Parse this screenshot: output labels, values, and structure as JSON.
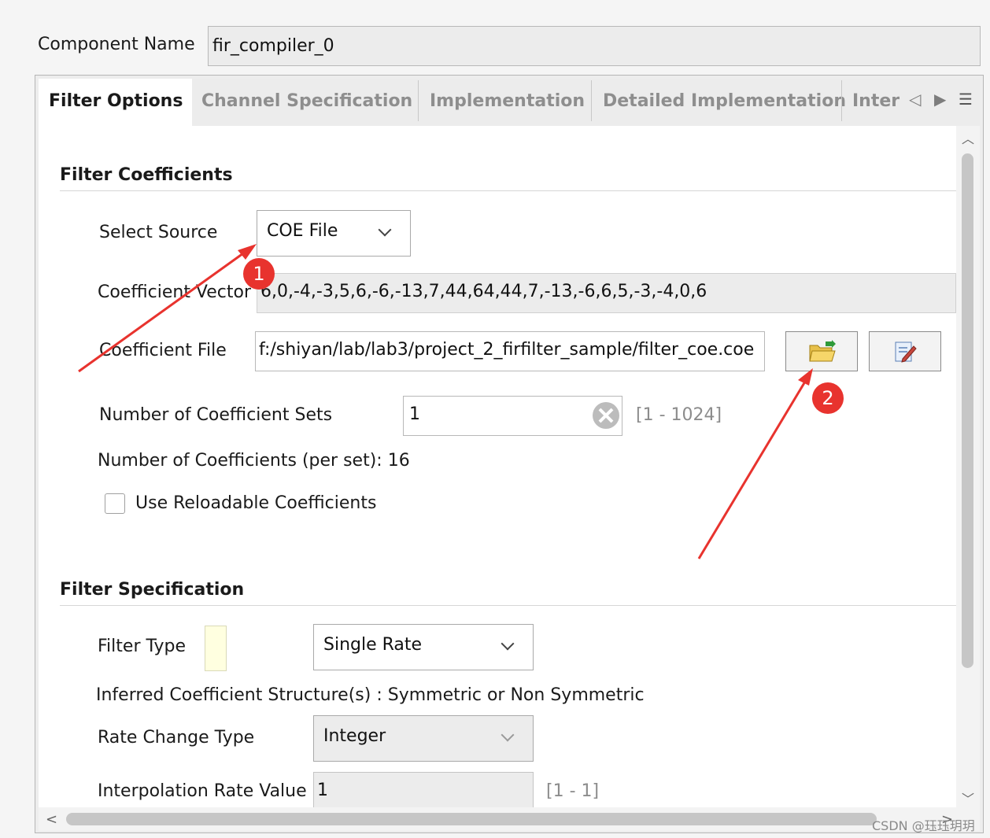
{
  "component": {
    "label": "Component Name",
    "value": "fir_compiler_0"
  },
  "tabs": [
    {
      "label": "Filter Options",
      "active": true
    },
    {
      "label": "Channel Specification",
      "active": false
    },
    {
      "label": "Implementation",
      "active": false
    },
    {
      "label": "Detailed Implementation",
      "active": false
    },
    {
      "label": "Inter",
      "active": false
    }
  ],
  "filter_coefficients": {
    "title": "Filter Coefficients",
    "select_source_label": "Select Source",
    "select_source_value": "COE File",
    "coefficient_vector_label": "Coefficient Vector",
    "coefficient_vector_value": "6,0,-4,-3,5,6,-6,-13,7,44,64,44,7,-13,-6,6,5,-3,-4,0,6",
    "coefficient_file_label": "Coefficient File",
    "coefficient_file_value": "f:/shiyan/lab/lab3/project_2_firfilter_sample/filter_coe.coe",
    "num_sets_label": "Number of Coefficient Sets",
    "num_sets_value": "1",
    "num_sets_range": "[1 - 1024]",
    "num_coeffs_text": "Number of Coefficients (per set): 16",
    "reloadable_label": "Use Reloadable Coefficients",
    "reloadable_checked": false
  },
  "filter_specification": {
    "title": "Filter Specification",
    "filter_type_label": "Filter Type",
    "filter_type_value": "Single Rate",
    "inferred_text": "Inferred Coefficient Structure(s) : Symmetric or Non Symmetric",
    "rate_change_label": "Rate Change Type",
    "rate_change_value": "Integer",
    "interp_label": "Interpolation Rate Value",
    "interp_value": "1",
    "interp_range": "[1 - 1]"
  },
  "annotations": {
    "badge1": "1",
    "badge2": "2",
    "color": "#e8332e"
  },
  "watermark": "CSDN @珏珏玥玥",
  "icons": {
    "open_file": "folder-open-icon",
    "edit_file": "edit-icon"
  }
}
